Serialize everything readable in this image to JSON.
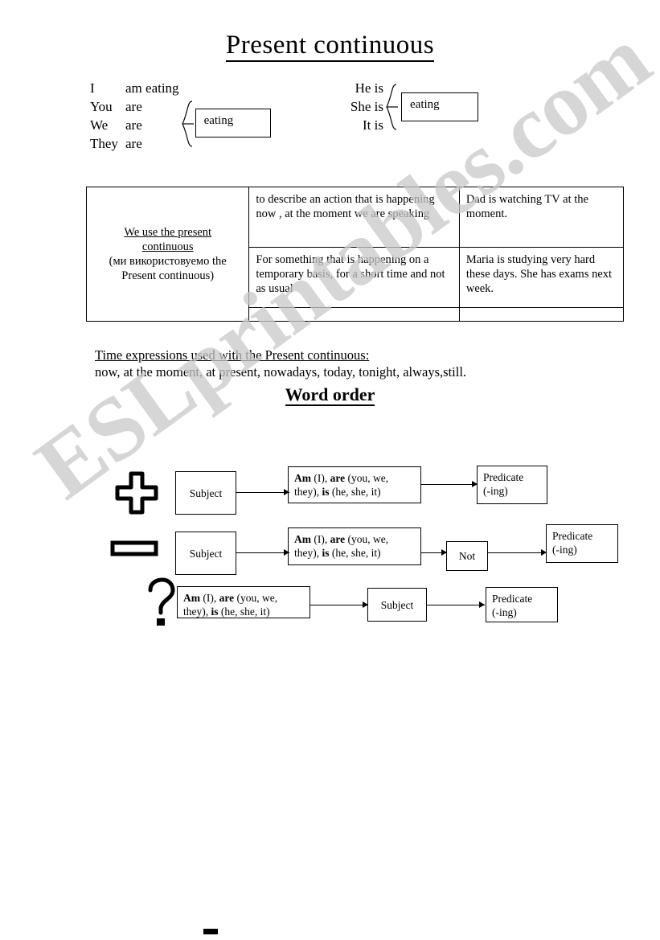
{
  "page": {
    "title": "Present continuous",
    "watermark": "ESLprintables.com"
  },
  "conjugation": {
    "left": {
      "rows": [
        {
          "pronoun": "I",
          "verb": "am eating"
        },
        {
          "pronoun": "You",
          "verb": "are"
        },
        {
          "pronoun": "We",
          "verb": "are"
        },
        {
          "pronoun": "They",
          "verb": "are"
        }
      ],
      "box_label": "eating"
    },
    "right": {
      "rows": [
        {
          "text": "He is"
        },
        {
          "text": "She is"
        },
        {
          "text": "It is"
        }
      ],
      "box_label": "eating"
    }
  },
  "usage_table": {
    "use_heading_line1": "We use the present",
    "use_heading_line2": "continuous",
    "use_translation": "(ми використовуемо the Present continuous)",
    "rows": [
      {
        "rule": "to describe an action that is happening now , at the moment we are speaking",
        "example": "Dad is watching TV at the moment."
      },
      {
        "rule": "For something that is happening on a temporary basis, for a short time and not as usual",
        "example": "Maria is studying very hard these days. She has exams next week."
      },
      {
        "rule": "",
        "example": ""
      }
    ]
  },
  "time_expressions": {
    "heading": "Time expressions used with the Present continuous:",
    "list": "now, at the moment, at present, nowadays, today, tonight, always,still."
  },
  "word_order": {
    "heading": "Word order",
    "verb_box_parts": {
      "am": "Am",
      "am_tail": " (I), ",
      "are": "are",
      "are_tail": " (you, we, they), ",
      "is": "is",
      "is_tail": " (he, she, it)"
    },
    "rows": [
      {
        "sign": "plus-sign",
        "boxes": [
          "Subject",
          "verb-box",
          "Predicate (-ing)"
        ]
      },
      {
        "sign": "minus-sign",
        "boxes": [
          "Subject",
          "verb-box",
          "Not",
          "Predicate (-ing)"
        ]
      },
      {
        "sign": "question-mark",
        "boxes": [
          "verb-box",
          "Subject",
          "Predicate (-ing)"
        ]
      }
    ],
    "labels": {
      "subject": "Subject",
      "not": "Not",
      "predicate_line1": "Predicate",
      "predicate_line2": "(-ing)"
    }
  }
}
